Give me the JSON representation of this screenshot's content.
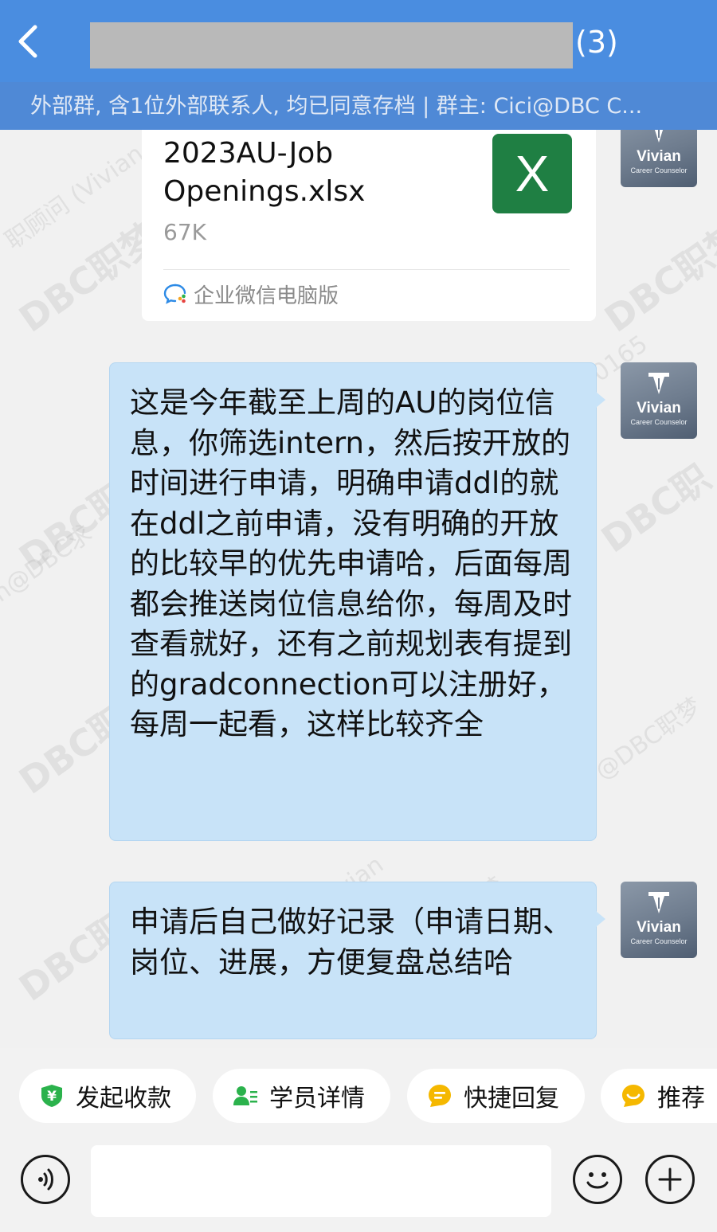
{
  "header": {
    "member_count": "(3)",
    "subtitle": "外部群, 含1位外部联系人, 均已同意存档 | 群主: Cici@DBC C..."
  },
  "watermarks": [
    "职顾问 (Vivian",
    "DBC职梦",
    "DBC职梦",
    "0165",
    "n@DBC求",
    "DBC职梦",
    "DBC职",
    "@DBC职梦",
    "职顾问(Vivian",
    "DBC职梦",
    "DBC职梦",
    "梦"
  ],
  "file_message": {
    "file_name": "2023AU-Job Openings.xlsx",
    "file_size": "67K",
    "icon_letter": "X",
    "source": "企业微信电脑版"
  },
  "avatar": {
    "name": "Vivian",
    "role": "Career Counselor"
  },
  "messages": [
    {
      "text": "这是今年截至上周的AU的岗位信息，你筛选intern，然后按开放的时间进行申请，明确申请ddl的就在ddl之前申请，没有明确的开放的比较早的优先申请哈，后面每周都会推送岗位信息给你，每周及时查看就好，还有之前规划表有提到的gradconnection可以注册好，每周一起看，这样比较齐全"
    },
    {
      "text": "申请后自己做好记录（申请日期、岗位、进展，方便复盘总结哈"
    }
  ],
  "quick_actions": [
    {
      "label": "发起收款",
      "icon": "yuan-shield-icon",
      "color": "#2bb24c"
    },
    {
      "label": "学员详情",
      "icon": "user-list-icon",
      "color": "#2bb24c"
    },
    {
      "label": "快捷回复",
      "icon": "quick-reply-icon",
      "color": "#f5b800"
    },
    {
      "label": "推荐",
      "icon": "recommend-icon",
      "color": "#f5b800"
    }
  ],
  "colors": {
    "header_bg": "#4a8de0",
    "bubble_bg": "#c8e3f8",
    "excel_green": "#1f7f43"
  }
}
